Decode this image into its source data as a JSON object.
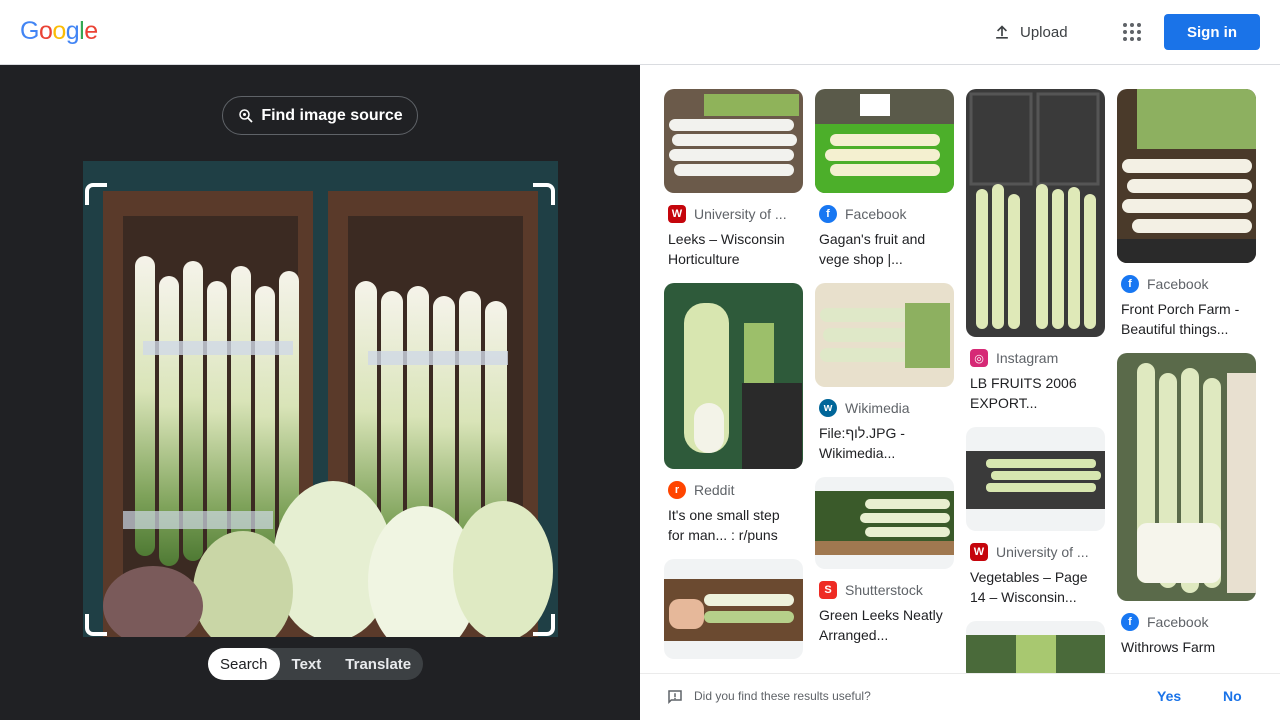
{
  "header": {
    "logo_letters": [
      "G",
      "o",
      "o",
      "g",
      "l",
      "e"
    ],
    "logo_colors": [
      "#4285f4",
      "#ea4335",
      "#fbbc05",
      "#4285f4",
      "#34a853",
      "#ea4335"
    ],
    "upload_label": "Upload",
    "signin_label": "Sign in",
    "apps_icon": "apps-grid-icon"
  },
  "left_panel": {
    "find_source_label": "Find image source",
    "modes": [
      "Search",
      "Text",
      "Translate"
    ],
    "active_mode": "Search"
  },
  "results": {
    "columns": [
      [
        {
          "source": "University of ...",
          "source_icon": "W",
          "source_color": "#c5050c",
          "title": "Leeks – Wisconsin Horticulture"
        },
        {
          "source": "Reddit",
          "source_icon": "r",
          "source_color": "#ff4500",
          "title": "It's one small step for man... : r/puns"
        },
        {
          "source": "",
          "source_icon": "",
          "source_color": "",
          "title": ""
        }
      ],
      [
        {
          "source": "Facebook",
          "source_icon": "f",
          "source_color": "#1877f2",
          "title": "Gagan's fruit and vege shop |..."
        },
        {
          "source": "Wikimedia",
          "source_icon": "w",
          "source_color": "#006699",
          "title": "File:לוף.JPG - Wikimedia..."
        },
        {
          "source": "Shutterstock",
          "source_icon": "S",
          "source_color": "#ee2b24",
          "title": "Green Leeks Neatly Arranged..."
        }
      ],
      [
        {
          "source": "Instagram",
          "source_icon": "◎",
          "source_color": "#d62976",
          "title": "LB FRUITS 2006 EXPORT..."
        },
        {
          "source": "University of ...",
          "source_icon": "W",
          "source_color": "#c5050c",
          "title": "Vegetables – Page 14 – Wisconsin..."
        },
        {
          "source": "",
          "source_icon": "",
          "source_color": "",
          "title": ""
        }
      ],
      [
        {
          "source": "Facebook",
          "source_icon": "f",
          "source_color": "#1877f2",
          "title": "Front Porch Farm - Beautiful things..."
        },
        {
          "source": "Facebook",
          "source_icon": "f",
          "source_color": "#1877f2",
          "title": "Withrows Farm"
        }
      ]
    ]
  },
  "feedback": {
    "question": "Did you find these results useful?",
    "yes_label": "Yes",
    "no_label": "No"
  }
}
